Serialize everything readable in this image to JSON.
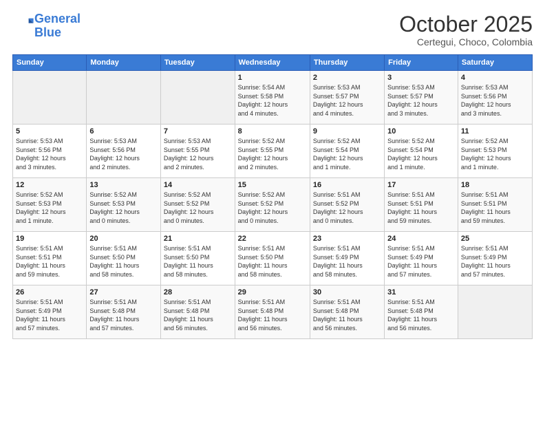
{
  "header": {
    "logo_line1": "General",
    "logo_line2": "Blue",
    "month_title": "October 2025",
    "subtitle": "Certegui, Choco, Colombia"
  },
  "days_of_week": [
    "Sunday",
    "Monday",
    "Tuesday",
    "Wednesday",
    "Thursday",
    "Friday",
    "Saturday"
  ],
  "weeks": [
    [
      {
        "day": "",
        "detail": ""
      },
      {
        "day": "",
        "detail": ""
      },
      {
        "day": "",
        "detail": ""
      },
      {
        "day": "1",
        "detail": "Sunrise: 5:54 AM\nSunset: 5:58 PM\nDaylight: 12 hours\nand 4 minutes."
      },
      {
        "day": "2",
        "detail": "Sunrise: 5:53 AM\nSunset: 5:57 PM\nDaylight: 12 hours\nand 4 minutes."
      },
      {
        "day": "3",
        "detail": "Sunrise: 5:53 AM\nSunset: 5:57 PM\nDaylight: 12 hours\nand 3 minutes."
      },
      {
        "day": "4",
        "detail": "Sunrise: 5:53 AM\nSunset: 5:56 PM\nDaylight: 12 hours\nand 3 minutes."
      }
    ],
    [
      {
        "day": "5",
        "detail": "Sunrise: 5:53 AM\nSunset: 5:56 PM\nDaylight: 12 hours\nand 3 minutes."
      },
      {
        "day": "6",
        "detail": "Sunrise: 5:53 AM\nSunset: 5:56 PM\nDaylight: 12 hours\nand 2 minutes."
      },
      {
        "day": "7",
        "detail": "Sunrise: 5:53 AM\nSunset: 5:55 PM\nDaylight: 12 hours\nand 2 minutes."
      },
      {
        "day": "8",
        "detail": "Sunrise: 5:52 AM\nSunset: 5:55 PM\nDaylight: 12 hours\nand 2 minutes."
      },
      {
        "day": "9",
        "detail": "Sunrise: 5:52 AM\nSunset: 5:54 PM\nDaylight: 12 hours\nand 1 minute."
      },
      {
        "day": "10",
        "detail": "Sunrise: 5:52 AM\nSunset: 5:54 PM\nDaylight: 12 hours\nand 1 minute."
      },
      {
        "day": "11",
        "detail": "Sunrise: 5:52 AM\nSunset: 5:53 PM\nDaylight: 12 hours\nand 1 minute."
      }
    ],
    [
      {
        "day": "12",
        "detail": "Sunrise: 5:52 AM\nSunset: 5:53 PM\nDaylight: 12 hours\nand 1 minute."
      },
      {
        "day": "13",
        "detail": "Sunrise: 5:52 AM\nSunset: 5:53 PM\nDaylight: 12 hours\nand 0 minutes."
      },
      {
        "day": "14",
        "detail": "Sunrise: 5:52 AM\nSunset: 5:52 PM\nDaylight: 12 hours\nand 0 minutes."
      },
      {
        "day": "15",
        "detail": "Sunrise: 5:52 AM\nSunset: 5:52 PM\nDaylight: 12 hours\nand 0 minutes."
      },
      {
        "day": "16",
        "detail": "Sunrise: 5:51 AM\nSunset: 5:52 PM\nDaylight: 12 hours\nand 0 minutes."
      },
      {
        "day": "17",
        "detail": "Sunrise: 5:51 AM\nSunset: 5:51 PM\nDaylight: 11 hours\nand 59 minutes."
      },
      {
        "day": "18",
        "detail": "Sunrise: 5:51 AM\nSunset: 5:51 PM\nDaylight: 11 hours\nand 59 minutes."
      }
    ],
    [
      {
        "day": "19",
        "detail": "Sunrise: 5:51 AM\nSunset: 5:51 PM\nDaylight: 11 hours\nand 59 minutes."
      },
      {
        "day": "20",
        "detail": "Sunrise: 5:51 AM\nSunset: 5:50 PM\nDaylight: 11 hours\nand 58 minutes."
      },
      {
        "day": "21",
        "detail": "Sunrise: 5:51 AM\nSunset: 5:50 PM\nDaylight: 11 hours\nand 58 minutes."
      },
      {
        "day": "22",
        "detail": "Sunrise: 5:51 AM\nSunset: 5:50 PM\nDaylight: 11 hours\nand 58 minutes."
      },
      {
        "day": "23",
        "detail": "Sunrise: 5:51 AM\nSunset: 5:49 PM\nDaylight: 11 hours\nand 58 minutes."
      },
      {
        "day": "24",
        "detail": "Sunrise: 5:51 AM\nSunset: 5:49 PM\nDaylight: 11 hours\nand 57 minutes."
      },
      {
        "day": "25",
        "detail": "Sunrise: 5:51 AM\nSunset: 5:49 PM\nDaylight: 11 hours\nand 57 minutes."
      }
    ],
    [
      {
        "day": "26",
        "detail": "Sunrise: 5:51 AM\nSunset: 5:49 PM\nDaylight: 11 hours\nand 57 minutes."
      },
      {
        "day": "27",
        "detail": "Sunrise: 5:51 AM\nSunset: 5:48 PM\nDaylight: 11 hours\nand 57 minutes."
      },
      {
        "day": "28",
        "detail": "Sunrise: 5:51 AM\nSunset: 5:48 PM\nDaylight: 11 hours\nand 56 minutes."
      },
      {
        "day": "29",
        "detail": "Sunrise: 5:51 AM\nSunset: 5:48 PM\nDaylight: 11 hours\nand 56 minutes."
      },
      {
        "day": "30",
        "detail": "Sunrise: 5:51 AM\nSunset: 5:48 PM\nDaylight: 11 hours\nand 56 minutes."
      },
      {
        "day": "31",
        "detail": "Sunrise: 5:51 AM\nSunset: 5:48 PM\nDaylight: 11 hours\nand 56 minutes."
      },
      {
        "day": "",
        "detail": ""
      }
    ]
  ]
}
